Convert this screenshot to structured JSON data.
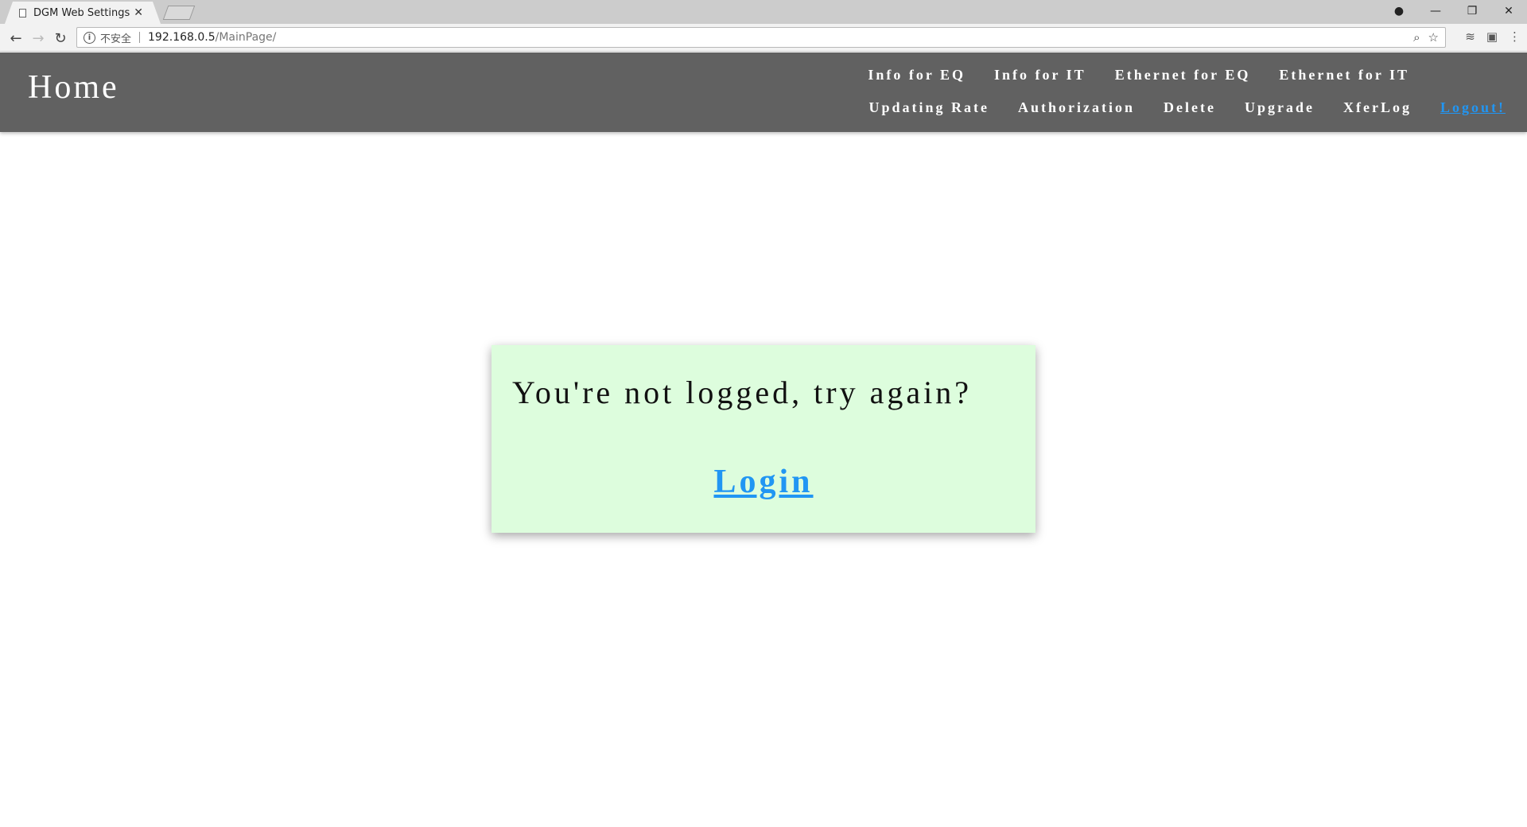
{
  "browser": {
    "tab_title": "DGM Web Settings",
    "tab_close": "✕",
    "security_label": "不安全",
    "url_host": "192.168.0.5",
    "url_path": "/MainPage/",
    "window_controls": {
      "minimize": "—",
      "restore": "❐",
      "close": "✕"
    }
  },
  "header": {
    "title": "Home",
    "nav_row1": [
      "Info for EQ",
      "Info for IT",
      "Ethernet for EQ",
      "Ethernet for IT"
    ],
    "nav_row2": [
      "Updating Rate",
      "Authorization",
      "Delete",
      "Upgrade",
      "XferLog"
    ],
    "logout_label": "Logout!",
    "logout_color": "#2196F3",
    "background_color": "#616161"
  },
  "dialog": {
    "message": "You're not logged, try again?",
    "login_label": "Login",
    "background_color": "#ddfddd"
  }
}
